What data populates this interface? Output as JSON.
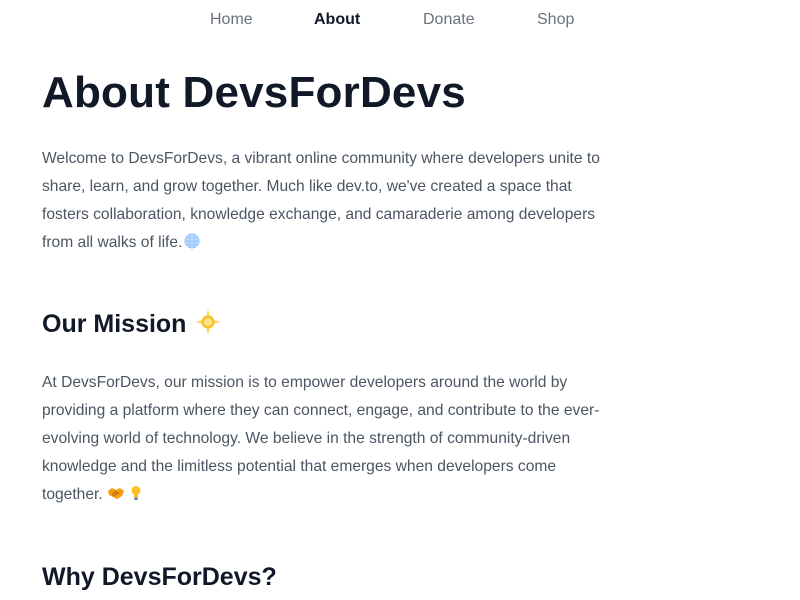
{
  "nav": {
    "items": [
      {
        "label": "Home",
        "active": false
      },
      {
        "label": "About",
        "active": true
      },
      {
        "label": "Donate",
        "active": false
      },
      {
        "label": "Shop",
        "active": false
      }
    ]
  },
  "page": {
    "title": "About DevsForDevs",
    "intro": "Welcome to DevsForDevs, a vibrant online community where developers unite to share, learn, and grow together. Much like dev.to, we've created a space that fosters collaboration, knowledge exchange, and camaraderie among developers from all walks of life.",
    "intro_icon": "globe-icon",
    "mission": {
      "heading": "Our Mission",
      "heading_icon": "glowing-star-icon",
      "text": "At DevsForDevs, our mission is to empower developers around the world by providing a platform where they can connect, engage, and contribute to the ever-evolving world of technology. We believe in the strength of community-driven knowledge and the limitless potential that emerges when developers come together.",
      "icons": [
        "handshake-icon",
        "lightbulb-icon"
      ]
    },
    "why": {
      "heading": "Why DevsForDevs?"
    }
  },
  "colors": {
    "heading": "#111827",
    "body_text": "#4b5563",
    "nav_inactive": "#6b7280",
    "nav_active": "#111827",
    "background": "#ffffff"
  }
}
